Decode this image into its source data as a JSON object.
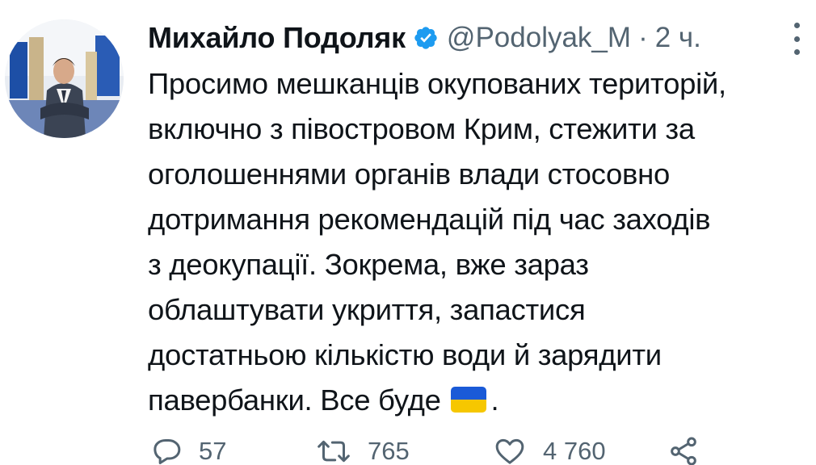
{
  "author": {
    "name": "Михайло Подоляк",
    "handle": "@Podolyak_M",
    "separator": "·",
    "time": "2 ч."
  },
  "icons": {
    "verified": "verified-badge-icon",
    "more": "more-options-icon",
    "reply": "reply-icon",
    "retweet": "retweet-icon",
    "like": "like-icon",
    "share": "share-icon",
    "flag": "ukraine-flag-emoji"
  },
  "colors": {
    "verified": "#1d9bf0",
    "text": "#0f1419",
    "secondary": "#536471",
    "flag_blue": "#1a5ad7",
    "flag_yellow": "#f6c700"
  },
  "tweet": {
    "lines": [
      "Просимо мешканців окупованих територій,",
      "включно з півостровом Крим, стежити за",
      "оголошеннями органів влади стосовно",
      "дотримання рекомендацій під час заходів",
      "з деокупації. Зокрема, вже зараз",
      "облаштувати укриття, запастися",
      "достатньою кількістю води й зарядити"
    ],
    "last_line_before_emoji": "павербанки. Все буде",
    "last_line_after_emoji": "."
  },
  "stats": {
    "replies": "57",
    "retweets": "765",
    "likes": "4 760"
  }
}
